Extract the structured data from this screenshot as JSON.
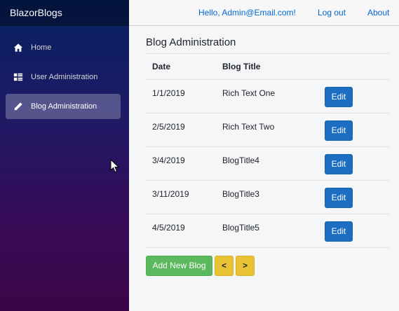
{
  "app": {
    "brand": "BlazorBlogs"
  },
  "sidebar": {
    "items": [
      {
        "label": "Home",
        "icon": "home-icon",
        "active": false
      },
      {
        "label": "User Administration",
        "icon": "list-icon",
        "active": false
      },
      {
        "label": "Blog Administration",
        "icon": "pencil-icon",
        "active": true
      }
    ]
  },
  "topbar": {
    "greeting": "Hello, Admin@Email.com!",
    "logout": "Log out",
    "about": "About"
  },
  "main": {
    "title": "Blog Administration",
    "columns": [
      "Date",
      "Blog Title"
    ],
    "rows": [
      {
        "date": "1/1/2019",
        "title": "Rich Text One",
        "action": "Edit"
      },
      {
        "date": "2/5/2019",
        "title": "Rich Text Two",
        "action": "Edit"
      },
      {
        "date": "3/4/2019",
        "title": "BlogTitle4",
        "action": "Edit"
      },
      {
        "date": "3/11/2019",
        "title": "BlogTitle3",
        "action": "Edit"
      },
      {
        "date": "4/5/2019",
        "title": "BlogTitle5",
        "action": "Edit"
      }
    ],
    "add_label": "Add New Blog",
    "prev_label": "<",
    "next_label": ">"
  },
  "colors": {
    "primary": "#1b6ec2",
    "success": "#5cb85c",
    "warning": "#e8c234",
    "link": "#0366d6"
  }
}
